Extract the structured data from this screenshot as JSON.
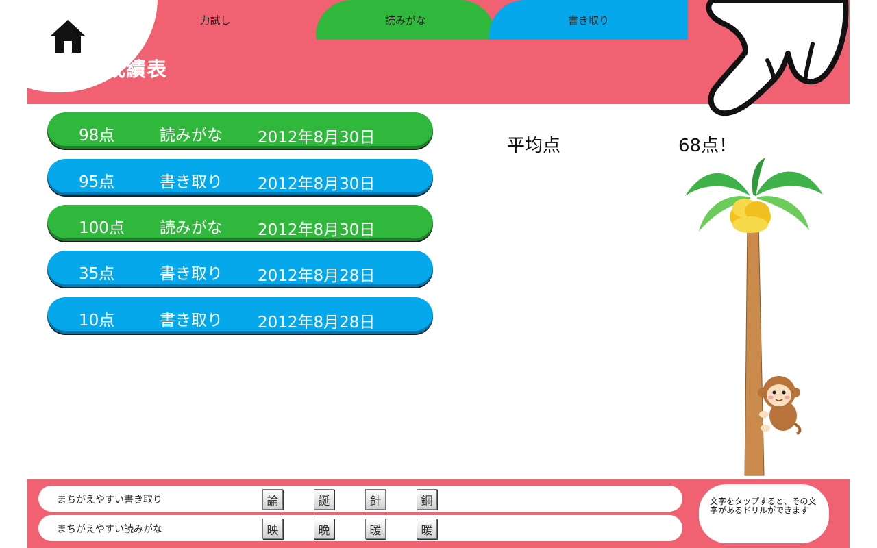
{
  "header": {
    "title": "成績表",
    "tabs": [
      {
        "label": "力試し",
        "color": "#f06272"
      },
      {
        "label": "読みがな",
        "color": "#2fb83c"
      },
      {
        "label": "書き取り",
        "color": "#05a8ea"
      }
    ]
  },
  "results": [
    {
      "score": "98点",
      "type": "読みがな",
      "date": "2012年8月30日",
      "color": "#2fb83c"
    },
    {
      "score": "95点",
      "type": "書き取り",
      "date": "2012年8月30日",
      "color": "#05a8ea"
    },
    {
      "score": "100点",
      "type": "読みがな",
      "date": "2012年8月30日",
      "color": "#2fb83c"
    },
    {
      "score": "35点",
      "type": "書き取り",
      "date": "2012年8月28日",
      "color": "#05a8ea"
    },
    {
      "score": "10点",
      "type": "書き取り",
      "date": "2012年8月28日",
      "color": "#05a8ea"
    }
  ],
  "average": {
    "label": "平均点",
    "value": "68点！"
  },
  "footer": {
    "writing_mistakes": {
      "label": "まちがえやすい書き取り",
      "kanji": [
        "論",
        "誕",
        "針",
        "鋼"
      ]
    },
    "reading_mistakes": {
      "label": "まちがえやすい読みがな",
      "kanji": [
        "映",
        "晩",
        "暖",
        "暖"
      ]
    },
    "hint": "文字をタップすると、その文字があるドリルができます"
  },
  "icons": {
    "home": "home-icon",
    "pointer": "pointing-hand-icon"
  }
}
